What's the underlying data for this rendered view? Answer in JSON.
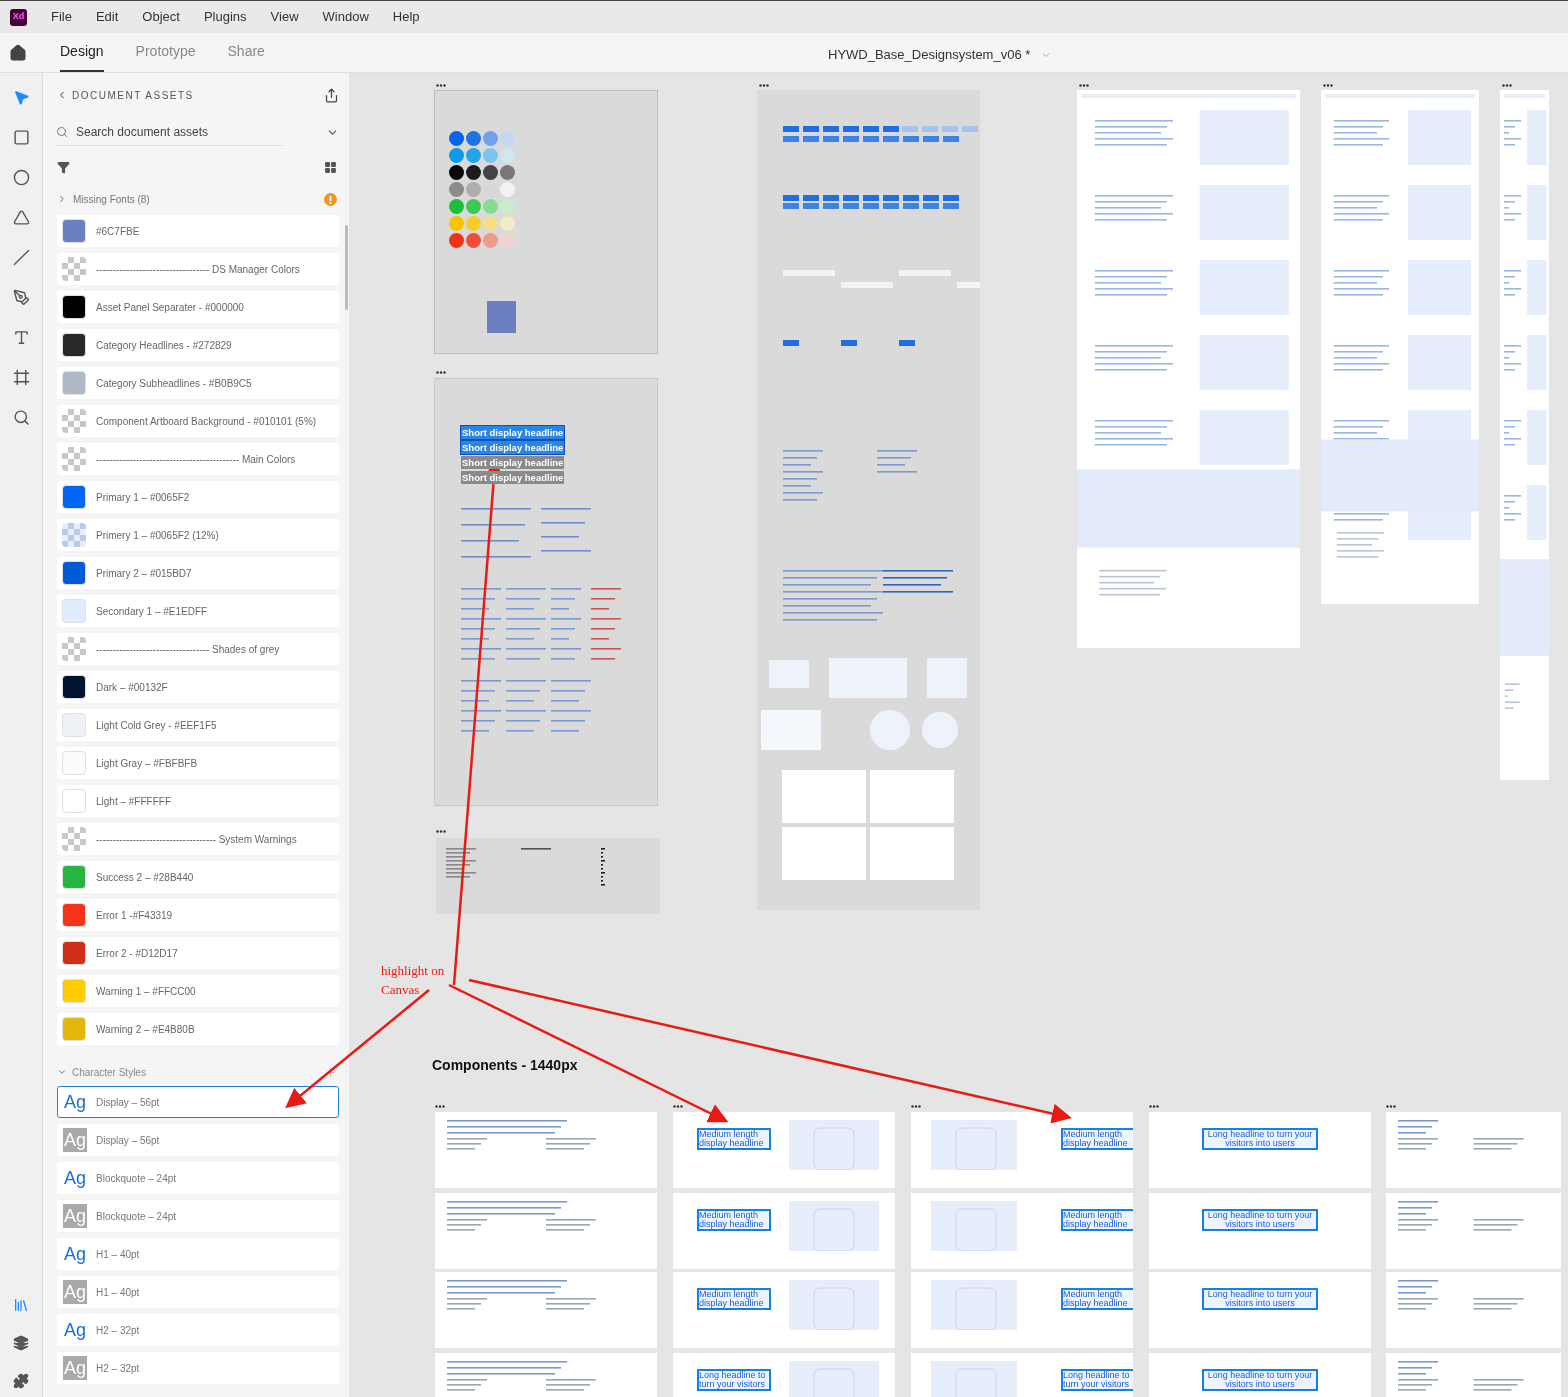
{
  "menu": [
    "File",
    "Edit",
    "Object",
    "Plugins",
    "View",
    "Window",
    "Help"
  ],
  "app_badge": "Xd",
  "tabs": [
    {
      "label": "Design",
      "selected": true
    },
    {
      "label": "Prototype",
      "selected": false
    },
    {
      "label": "Share",
      "selected": false
    }
  ],
  "document_title": "HYWD_Base_Designsystem_v06 *",
  "assets": {
    "title": "DOCUMENT ASSETS",
    "search": {
      "placeholder": "Search document assets"
    },
    "missing_fonts": "Missing Fonts (8)",
    "colors": [
      {
        "label": "#6C7FBE",
        "kind": "solid",
        "color": "#6c7fbe"
      },
      {
        "label": "---------------------------------- DS Manager Colors",
        "kind": "checker"
      },
      {
        "label": "Asset Panel Separater - #000000",
        "kind": "solid",
        "color": "#000000"
      },
      {
        "label": "Category Headlines - #272829",
        "kind": "solid",
        "color": "#272829"
      },
      {
        "label": "Category Subheadlines - #B0B9C5",
        "kind": "solid",
        "color": "#b0b9c5"
      },
      {
        "label": "Component Artboard Background - #010101 (5%)",
        "kind": "checker"
      },
      {
        "label": "------------------------------------------- Main Colors",
        "kind": "checker"
      },
      {
        "label": "Primary 1 – #0065F2",
        "kind": "solid",
        "color": "#0065f2"
      },
      {
        "label": "Primery 1 – #0065F2 (12%)",
        "kind": "tint"
      },
      {
        "label": "Primary 2 – #015BD7",
        "kind": "solid",
        "color": "#015bd7"
      },
      {
        "label": "Secondary 1 – #E1EDFF",
        "kind": "solid",
        "color": "#e1edff"
      },
      {
        "label": "---------------------------------- Shades of grey",
        "kind": "checker"
      },
      {
        "label": "Dark – #00132F",
        "kind": "solid",
        "color": "#00132f"
      },
      {
        "label": "Light Cold Grey - #EEF1F5",
        "kind": "solid",
        "color": "#eef1f5"
      },
      {
        "label": "Light Gray – #FBFBFB",
        "kind": "solid",
        "color": "#fbfbfb"
      },
      {
        "label": "Light – #FFFFFF",
        "kind": "solid",
        "color": "#ffffff"
      },
      {
        "label": "------------------------------------ System Warnings",
        "kind": "checker"
      },
      {
        "label": "Success 2 – #28B440",
        "kind": "solid",
        "color": "#28b440"
      },
      {
        "label": "Error 1 -#F43319",
        "kind": "solid",
        "color": "#f43319"
      },
      {
        "label": "Error 2 - #D12D17",
        "kind": "solid",
        "color": "#d12d17"
      },
      {
        "label": "Warning 1 – #FFCC00",
        "kind": "solid",
        "color": "#ffcc00"
      },
      {
        "label": "Warning 2 – #E4B80B",
        "kind": "solid",
        "color": "#e4b80b"
      }
    ],
    "character_styles_title": "Character Styles",
    "character_styles": [
      {
        "sample": "Ag",
        "label": "Display – 56pt",
        "kind": "color",
        "selected": true
      },
      {
        "sample": "Ag",
        "label": "Display – 56pt",
        "kind": "grey",
        "selected": false
      },
      {
        "sample": "Ag",
        "label": "Blockquote – 24pt",
        "kind": "color",
        "selected": false
      },
      {
        "sample": "Ag",
        "label": "Blockquote – 24pt",
        "kind": "grey",
        "selected": false
      },
      {
        "sample": "Ag",
        "label": "H1 – 40pt",
        "kind": "color",
        "selected": false
      },
      {
        "sample": "Ag",
        "label": "H1 – 40pt",
        "kind": "grey",
        "selected": false
      },
      {
        "sample": "Ag",
        "label": "H2 – 32pt",
        "kind": "color",
        "selected": false
      },
      {
        "sample": "Ag",
        "label": "H2 – 32pt",
        "kind": "grey",
        "selected": false
      }
    ]
  },
  "canvas": {
    "typography_headlines": [
      {
        "text": "Short display headline",
        "highlighted": true
      },
      {
        "text": "Short display headline",
        "highlighted": true
      },
      {
        "text": "Short display headline",
        "highlighted": false
      },
      {
        "text": "Short display headline",
        "highlighted": false
      }
    ],
    "annotation": "highlight on Canvas",
    "components_title": "Components - 1440px",
    "component_cards": [
      {
        "kind": "layout"
      },
      {
        "kind": "headline",
        "headline": "Medium length display headline",
        "highlighted": true
      },
      {
        "kind": "headline",
        "headline": "Medium length display headline",
        "highlighted": true
      },
      {
        "kind": "headline",
        "headline": "Long headline to turn your visitors into users",
        "highlighted": true
      },
      {
        "kind": "layout"
      },
      {
        "kind": "layout"
      },
      {
        "kind": "headline",
        "headline": "Medium length display headline",
        "highlighted": true
      },
      {
        "kind": "headline",
        "headline": "Medium length display headline",
        "highlighted": true
      },
      {
        "kind": "headline",
        "headline": "Long headline to turn your visitors into users",
        "highlighted": true
      },
      {
        "kind": "layout"
      },
      {
        "kind": "layout"
      },
      {
        "kind": "headline",
        "headline": "Medium length display headline",
        "highlighted": true
      },
      {
        "kind": "headline",
        "headline": "Medium length display headline",
        "highlighted": true
      },
      {
        "kind": "headline",
        "headline": "Long headline to turn your visitors into users",
        "highlighted": true
      },
      {
        "kind": "layout"
      },
      {
        "kind": "layout"
      },
      {
        "kind": "headline",
        "headline": "Long headline to turn your visitors",
        "highlighted": true
      },
      {
        "kind": "headline",
        "headline": "Long headline to turn your visitors",
        "highlighted": true
      },
      {
        "kind": "headline",
        "headline": "Long headline to turn your visitors into users",
        "highlighted": true
      },
      {
        "kind": "layout"
      }
    ]
  }
}
